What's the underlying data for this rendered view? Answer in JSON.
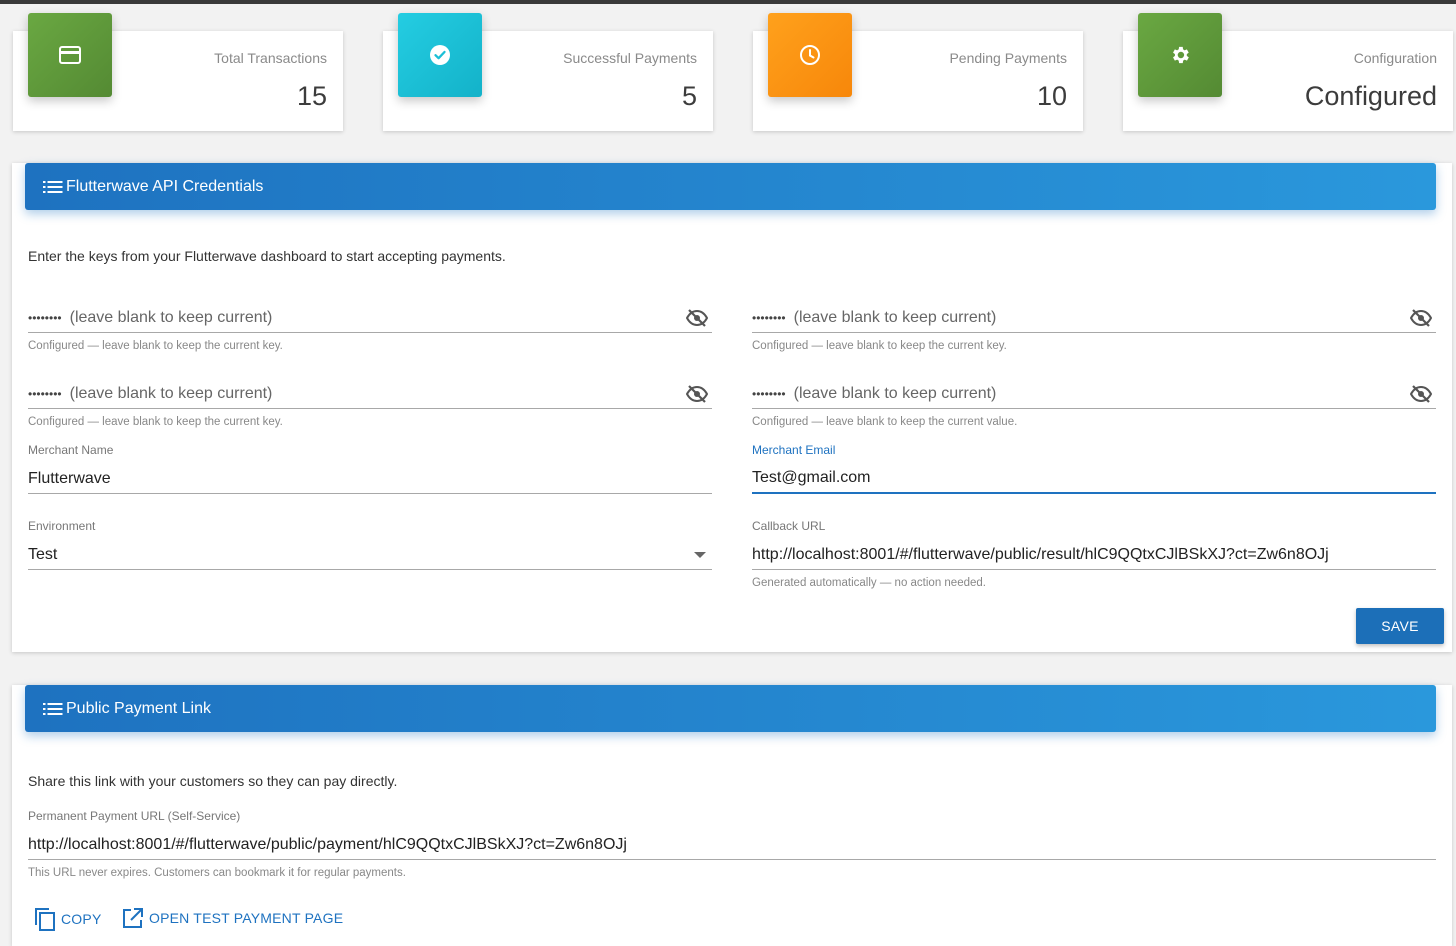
{
  "stats": [
    {
      "label": "Total Transactions",
      "value": "15",
      "icon": "credit-card-icon",
      "color": "#5f9a3a"
    },
    {
      "label": "Successful Payments",
      "value": "5",
      "icon": "check-circle-icon",
      "color": "#1cc3d9"
    },
    {
      "label": "Pending Payments",
      "value": "10",
      "icon": "clock-icon",
      "color": "#fb9313"
    },
    {
      "label": "Configuration",
      "value": "Configured",
      "icon": "gear-icon",
      "color": "#5f9a3a"
    }
  ],
  "credentials": {
    "title": "Flutterwave API Credentials",
    "description": "Enter the keys from your Flutterwave dashboard to start accepting payments.",
    "secret_fields": [
      {
        "dots": "••••••••",
        "placeholder": "(leave blank to keep current)",
        "hint": "Configured — leave blank to keep the current key."
      },
      {
        "dots": "••••••••",
        "placeholder": "(leave blank to keep current)",
        "hint": "Configured — leave blank to keep the current key."
      },
      {
        "dots": "••••••••",
        "placeholder": "(leave blank to keep current)",
        "hint": "Configured — leave blank to keep the current key."
      },
      {
        "dots": "••••••••",
        "placeholder": "(leave blank to keep current)",
        "hint": "Configured — leave blank to keep the current value."
      }
    ],
    "merchant_name": {
      "label": "Merchant Name",
      "value": "Flutterwave"
    },
    "merchant_email": {
      "label": "Merchant Email",
      "value": "Test@gmail.com"
    },
    "environment": {
      "label": "Environment",
      "value": "Test"
    },
    "callback_url": {
      "label": "Callback URL",
      "value": "http://localhost:8001/#/flutterwave/public/result/hlC9QQtxCJlBSkXJ?ct=Zw6n8OJj",
      "hint": "Generated automatically — no action needed."
    },
    "save_label": "SAVE"
  },
  "public_link": {
    "title": "Public Payment Link",
    "description": "Share this link with your customers so they can pay directly.",
    "url_label": "Permanent Payment URL (Self-Service)",
    "url": "http://localhost:8001/#/flutterwave/public/payment/hlC9QQtxCJlBSkXJ?ct=Zw6n8OJj",
    "url_hint": "This URL never expires. Customers can bookmark it for regular payments.",
    "copy_label": "COPY",
    "open_label": "OPEN TEST PAYMENT PAGE"
  },
  "colors": {
    "accent": "#1e72c0",
    "header_gradient_end": "#2a98dc"
  }
}
